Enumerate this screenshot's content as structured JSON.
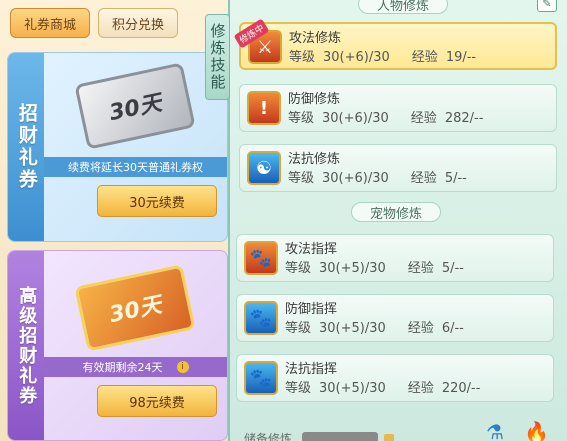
{
  "shop": {
    "tabs": [
      {
        "label": "礼券商城",
        "active": true
      },
      {
        "label": "积分兑换",
        "active": false
      }
    ],
    "cards": [
      {
        "side_label": "招财礼券",
        "ticket_text": "30天",
        "info_text": "续费将延长30天普通礼券权",
        "button_label": "30元续费"
      },
      {
        "side_label": "高级招财礼券",
        "ticket_text": "30天",
        "info_text": "有效期剩余24天",
        "info_icon": "i",
        "button_label": "98元续费"
      }
    ]
  },
  "skills": {
    "vertical_tab": "修炼技能",
    "section_human": "人物修炼",
    "section_pet": "宠物修炼",
    "level_label": "等级",
    "exp_label": "经验",
    "human": [
      {
        "name": "攻法修炼",
        "level": "30(+6)/30",
        "exp": "19/--",
        "badge": "修炼中",
        "icon": "attack-magic-icon",
        "active": true
      },
      {
        "name": "防御修炼",
        "level": "30(+6)/30",
        "exp": "282/--",
        "icon": "defense-icon",
        "active": false
      },
      {
        "name": "法抗修炼",
        "level": "30(+6)/30",
        "exp": "5/--",
        "icon": "magic-resist-icon",
        "active": false
      }
    ],
    "pet": [
      {
        "name": "攻法指挥",
        "level": "30(+5)/30",
        "exp": "5/--",
        "icon": "pet-attack-icon"
      },
      {
        "name": "防御指挥",
        "level": "30(+5)/30",
        "exp": "6/--",
        "icon": "pet-defense-icon"
      },
      {
        "name": "法抗指挥",
        "level": "30(+5)/30",
        "exp": "220/--",
        "icon": "pet-resist-icon"
      }
    ],
    "bottom_label": "储备修炼"
  },
  "colors": {
    "accent_gold": "#f2b43b",
    "blue_card": "#3c8fd0",
    "purple_card": "#8a56c7",
    "active_row": "#ffe894"
  }
}
